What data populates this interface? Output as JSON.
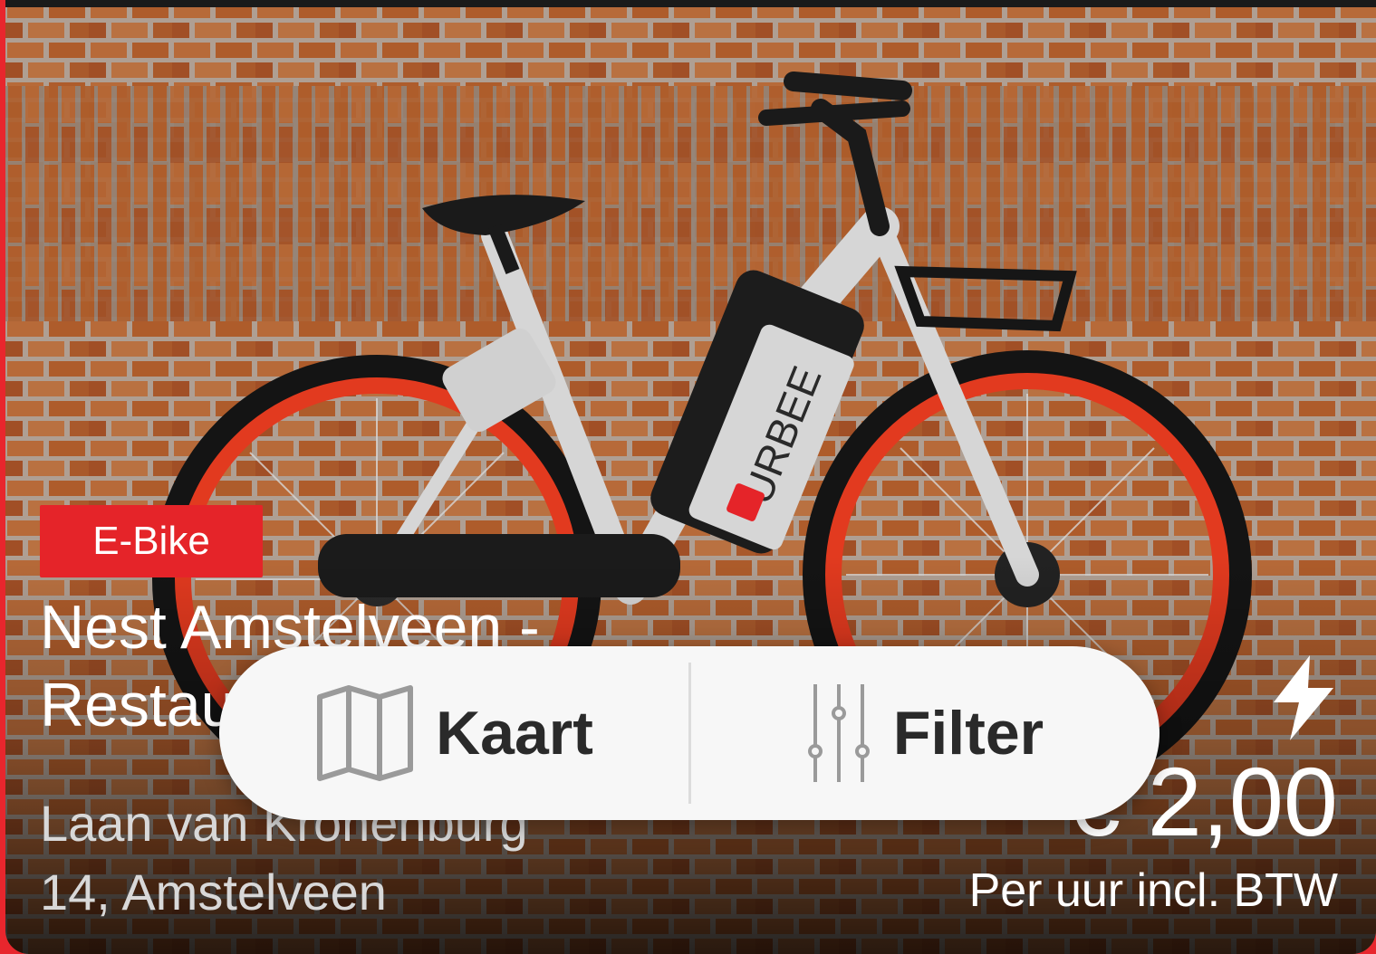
{
  "listing": {
    "badge": "E-Bike",
    "title_line1": "Nest Amstelveen -",
    "title_line2": "Restaurant",
    "address_line1": "Laan van Kronenburg",
    "address_line2": "14, Amstelveen",
    "price": "€ 2,00",
    "price_note": "Per uur incl. BTW",
    "brand_on_bike": "URBEE",
    "charge_icon": "lightning-bolt-icon"
  },
  "actions": {
    "map_label": "Kaart",
    "map_icon": "map-icon",
    "filter_label": "Filter",
    "filter_icon": "sliders-icon"
  },
  "colors": {
    "accent": "#e52429",
    "pill_bg": "#f7f7f7"
  }
}
